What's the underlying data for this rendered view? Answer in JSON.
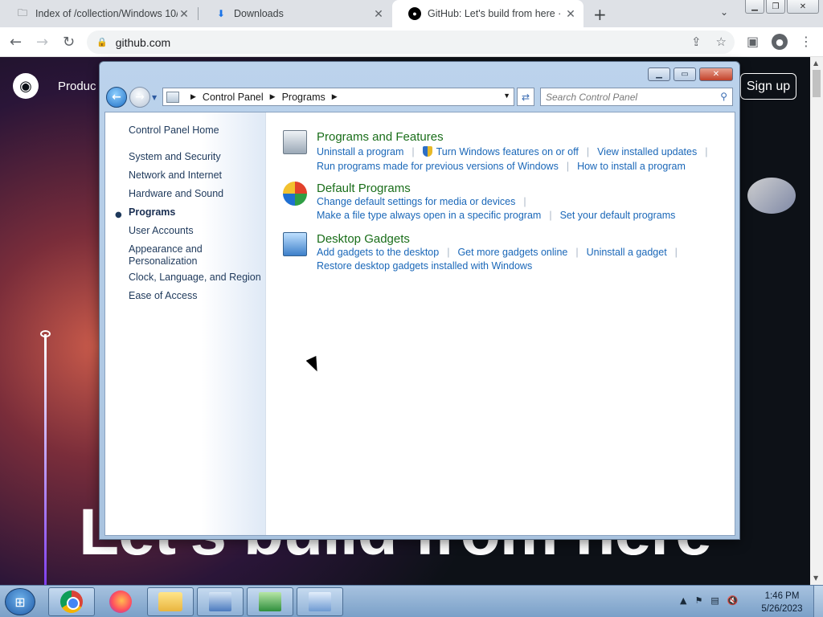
{
  "browser": {
    "tabs": [
      {
        "title": "Index of /collection/Windows 10/",
        "icon": "folder-icon"
      },
      {
        "title": "Downloads",
        "icon": "download-icon"
      },
      {
        "title": "GitHub: Let's build from here · Gi",
        "icon": "github-icon"
      }
    ],
    "url": "github.com"
  },
  "github": {
    "nav_product": "Produc",
    "signup": "Sign up",
    "hero": "Let's build from here"
  },
  "cp": {
    "breadcrumb": [
      "Control Panel",
      "Programs"
    ],
    "search_placeholder": "Search Control Panel",
    "left_nav": {
      "home": "Control Panel Home",
      "items": [
        "System and Security",
        "Network and Internet",
        "Hardware and Sound",
        "Programs",
        "User Accounts",
        "Appearance and",
        "Personalization",
        "Clock, Language, and Region",
        "Ease of Access"
      ]
    },
    "categories": [
      {
        "title": "Programs and Features",
        "links_row1": [
          "Uninstall a program",
          "Turn Windows features on or off",
          "View installed updates"
        ],
        "links_row2": [
          "Run programs made for previous versions of Windows",
          "How to install a program"
        ]
      },
      {
        "title": "Default Programs",
        "links_row1": [
          "Change default settings for media or devices"
        ],
        "links_row2": [
          "Make a file type always open in a specific program",
          "Set your default programs"
        ]
      },
      {
        "title": "Desktop Gadgets",
        "links_row1": [
          "Add gadgets to the desktop",
          "Get more gadgets online",
          "Uninstall a gadget"
        ],
        "links_row2": [
          "Restore desktop gadgets installed with Windows"
        ]
      }
    ]
  },
  "taskbar": {
    "time": "1:46 PM",
    "date": "5/26/2023"
  },
  "colors": {
    "category_title": "#1a6e1a",
    "link": "#1a67b8"
  }
}
